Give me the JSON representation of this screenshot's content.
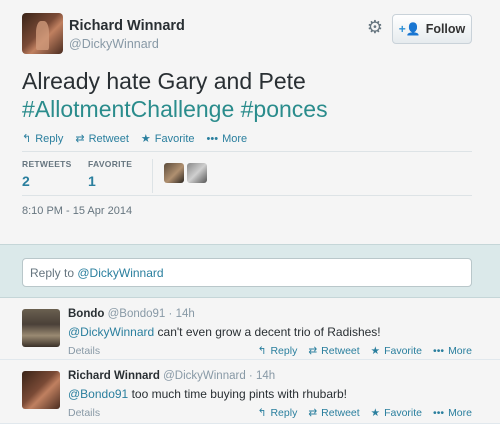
{
  "tweet": {
    "name": "Richard Winnard",
    "handle": "@DickyWinnard",
    "text_line1": "Already hate Gary and Pete",
    "hashtag1": "#AllotmentChallenge",
    "hashtag2": "#ponces",
    "follow_label": "Follow",
    "actions": {
      "reply": "Reply",
      "retweet": "Retweet",
      "favorite": "Favorite",
      "more": "More"
    },
    "stats": {
      "retweets_label": "RETWEETS",
      "retweets_value": "2",
      "favorite_label": "FAVORITE",
      "favorite_value": "1"
    },
    "timestamp": "8:10 PM - 15 Apr 2014"
  },
  "reply_box": {
    "prefix": "Reply to ",
    "mention": "@DickyWinnard"
  },
  "replies": [
    {
      "name": "Bondo",
      "handle": "@Bondo91",
      "time": "· 14h",
      "mention": "@DickyWinnard",
      "text": " can't even grow a decent trio of Radishes!",
      "details": "Details",
      "actions": {
        "reply": "Reply",
        "retweet": "Retweet",
        "favorite": "Favorite",
        "more": "More"
      }
    },
    {
      "name": "Richard Winnard",
      "handle": "@DickyWinnard",
      "time": "· 14h",
      "mention": "@Bondo91",
      "text": " too much time buying pints with rhubarb!",
      "details": "Details",
      "actions": {
        "reply": "Reply",
        "retweet": "Retweet",
        "favorite": "Favorite",
        "more": "More"
      }
    }
  ],
  "icons": {
    "reply": "reply-arrow-icon",
    "retweet": "retweet-icon",
    "favorite": "star-icon",
    "more": "ellipsis-icon",
    "settings": "gear-icon",
    "follow": "add-user-icon"
  },
  "colors": {
    "link": "#2a7f9e",
    "hashtag": "#2a8c8c",
    "reply_area_bg": "#dbe9ea"
  }
}
